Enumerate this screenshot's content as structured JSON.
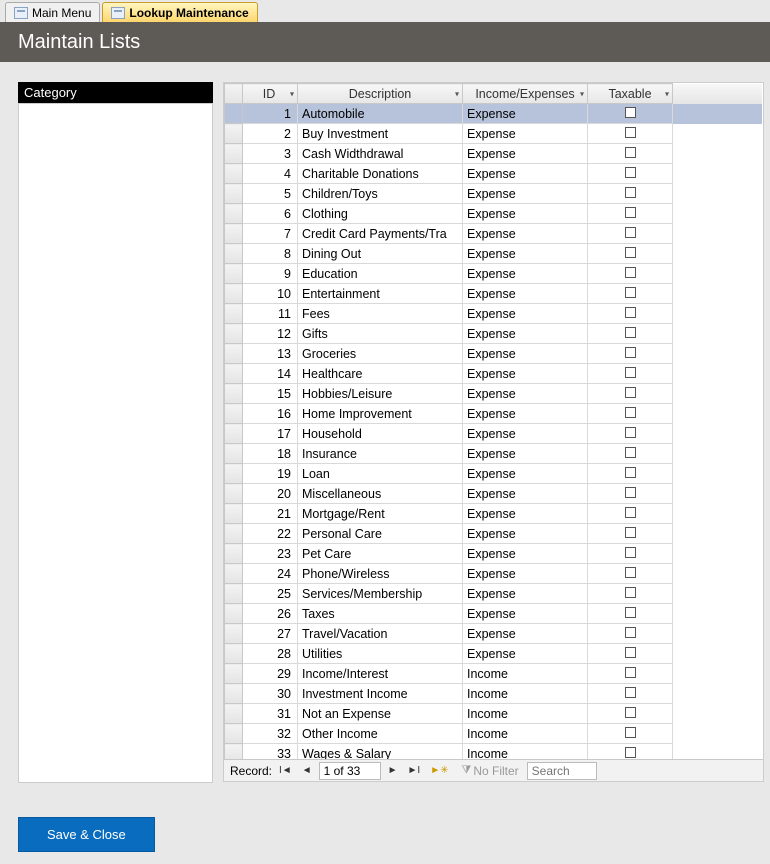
{
  "tabs": [
    {
      "label": "Main Menu",
      "active": false
    },
    {
      "label": "Lookup Maintenance",
      "active": true
    }
  ],
  "header_title": "Maintain Lists",
  "sidebar": {
    "title": "Category"
  },
  "grid": {
    "columns": {
      "id": "ID",
      "description": "Description",
      "income_expenses": "Income/Expenses",
      "taxable": "Taxable"
    },
    "rows": [
      {
        "id": 1,
        "description": "Automobile",
        "incexp": "Expense",
        "taxable": false,
        "selected": true
      },
      {
        "id": 2,
        "description": "Buy Investment",
        "incexp": "Expense",
        "taxable": false
      },
      {
        "id": 3,
        "description": "Cash Widthdrawal",
        "incexp": "Expense",
        "taxable": false
      },
      {
        "id": 4,
        "description": "Charitable Donations",
        "incexp": "Expense",
        "taxable": false
      },
      {
        "id": 5,
        "description": "Children/Toys",
        "incexp": "Expense",
        "taxable": false
      },
      {
        "id": 6,
        "description": "Clothing",
        "incexp": "Expense",
        "taxable": false
      },
      {
        "id": 7,
        "description": "Credit Card Payments/Tra",
        "incexp": "Expense",
        "taxable": false
      },
      {
        "id": 8,
        "description": "Dining Out",
        "incexp": "Expense",
        "taxable": false
      },
      {
        "id": 9,
        "description": "Education",
        "incexp": "Expense",
        "taxable": false
      },
      {
        "id": 10,
        "description": "Entertainment",
        "incexp": "Expense",
        "taxable": false
      },
      {
        "id": 11,
        "description": "Fees",
        "incexp": "Expense",
        "taxable": false
      },
      {
        "id": 12,
        "description": "Gifts",
        "incexp": "Expense",
        "taxable": false
      },
      {
        "id": 13,
        "description": "Groceries",
        "incexp": "Expense",
        "taxable": false
      },
      {
        "id": 14,
        "description": "Healthcare",
        "incexp": "Expense",
        "taxable": false
      },
      {
        "id": 15,
        "description": "Hobbies/Leisure",
        "incexp": "Expense",
        "taxable": false
      },
      {
        "id": 16,
        "description": "Home Improvement",
        "incexp": "Expense",
        "taxable": false
      },
      {
        "id": 17,
        "description": "Household",
        "incexp": "Expense",
        "taxable": false
      },
      {
        "id": 18,
        "description": "Insurance",
        "incexp": "Expense",
        "taxable": false
      },
      {
        "id": 19,
        "description": "Loan",
        "incexp": "Expense",
        "taxable": false
      },
      {
        "id": 20,
        "description": "Miscellaneous",
        "incexp": "Expense",
        "taxable": false
      },
      {
        "id": 21,
        "description": "Mortgage/Rent",
        "incexp": "Expense",
        "taxable": false
      },
      {
        "id": 22,
        "description": "Personal Care",
        "incexp": "Expense",
        "taxable": false
      },
      {
        "id": 23,
        "description": "Pet Care",
        "incexp": "Expense",
        "taxable": false
      },
      {
        "id": 24,
        "description": "Phone/Wireless",
        "incexp": "Expense",
        "taxable": false
      },
      {
        "id": 25,
        "description": "Services/Membership",
        "incexp": "Expense",
        "taxable": false
      },
      {
        "id": 26,
        "description": "Taxes",
        "incexp": "Expense",
        "taxable": false
      },
      {
        "id": 27,
        "description": "Travel/Vacation",
        "incexp": "Expense",
        "taxable": false
      },
      {
        "id": 28,
        "description": "Utilities",
        "incexp": "Expense",
        "taxable": false
      },
      {
        "id": 29,
        "description": "Income/Interest",
        "incexp": "Income",
        "taxable": false
      },
      {
        "id": 30,
        "description": "Investment Income",
        "incexp": "Income",
        "taxable": false
      },
      {
        "id": 31,
        "description": "Not an Expense",
        "incexp": "Income",
        "taxable": false
      },
      {
        "id": 32,
        "description": "Other Income",
        "incexp": "Income",
        "taxable": false
      },
      {
        "id": 33,
        "description": "Wages & Salary",
        "incexp": "Income",
        "taxable": false
      }
    ]
  },
  "record_nav": {
    "label": "Record:",
    "position": "1 of 33",
    "no_filter": "No Filter",
    "search_placeholder": "Search"
  },
  "buttons": {
    "save_close": "Save & Close"
  }
}
